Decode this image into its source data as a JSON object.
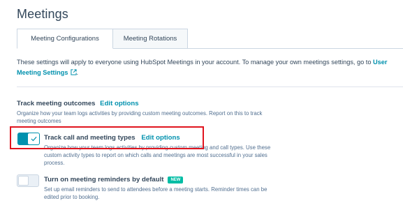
{
  "page": {
    "title": "Meetings"
  },
  "tabs": [
    {
      "label": "Meeting Configurations",
      "active": true
    },
    {
      "label": "Meeting Rotations",
      "active": false
    }
  ],
  "intro": {
    "text": "These settings will apply to everyone using HubSpot Meetings in your account. To manage your own meetings settings, go to ",
    "link_label": "User Meeting Settings",
    "link_icon": "external-link-icon",
    "trailing": "."
  },
  "track_outcomes": {
    "title": "Track meeting outcomes",
    "edit_label": "Edit options",
    "description": "Organize how your team logs activities by providing custom meeting outcomes. Report on this to track meeting outcomes"
  },
  "track_types": {
    "title": "Track call and meeting types",
    "edit_label": "Edit options",
    "description": "Organize how your team logs activities by providing custom meeting and call types. Use these custom activity types to report on which calls and meetings are most successful in your sales process.",
    "toggle_on": true
  },
  "reminders": {
    "title": "Turn on meeting reminders by default",
    "badge": "NEW",
    "description": "Set up email reminders to send to attendees before a meeting starts. Reminder times can be edited prior to booking.",
    "toggle_on": false
  },
  "colors": {
    "link": "#0091ae",
    "toggle_on": "#0091ae",
    "badge": "#00bda5",
    "highlight": "#e0141e",
    "text": "#33475b"
  }
}
